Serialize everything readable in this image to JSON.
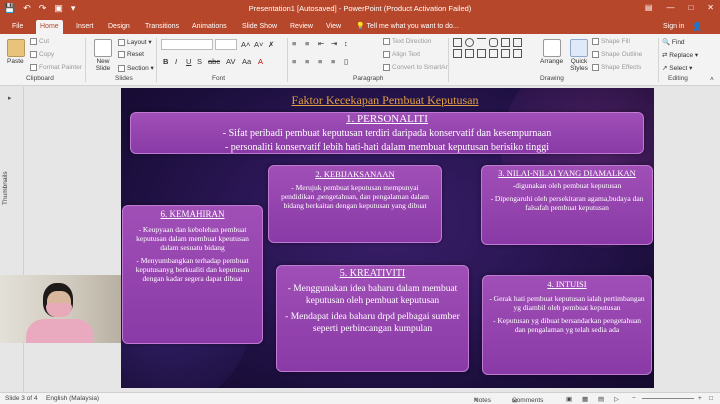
{
  "window": {
    "title": "Presentation1 [Autosaved] - PowerPoint (Product Activation Failed)",
    "controls": [
      "—",
      "□",
      "✕"
    ]
  },
  "tabs": [
    "File",
    "Home",
    "Insert",
    "Design",
    "Transitions",
    "Animations",
    "Slide Show",
    "Review",
    "View"
  ],
  "tell_me": "Tell me what you want to do...",
  "sign_in": "Sign in",
  "ribbon": {
    "clipboard": {
      "paste": "Paste",
      "cut": "Cut",
      "copy": "Copy",
      "format_painter": "Format Painter",
      "label": "Clipboard"
    },
    "slides": {
      "new_slide": "New Slide",
      "layout": "Layout",
      "reset": "Reset",
      "section": "Section",
      "label": "Slides"
    },
    "font": {
      "label": "Font"
    },
    "paragraph": {
      "text_direction": "Text Direction",
      "align_text": "Align Text",
      "convert_smartart": "Convert to SmartArt",
      "label": "Paragraph"
    },
    "drawing": {
      "arrange": "Arrange",
      "quick_styles": "Quick Styles",
      "shape_fill": "Shape Fill",
      "shape_outline": "Shape Outline",
      "shape_effects": "Shape Effects",
      "label": "Drawing"
    },
    "editing": {
      "find": "Find",
      "replace": "Replace",
      "select": "Select",
      "label": "Editing"
    }
  },
  "thumbnails_label": "Thumbnails",
  "slide": {
    "title": "Faktor Kecekapan Pembuat Keputusan",
    "boxes": {
      "personaliti": {
        "head": "1. PERSONALITI",
        "lines": [
          "- Sifat peribadi pembuat keputusan terdiri daripada konservatif dan kesempurnaan",
          "- personaliti konservatif lebih hati-hati dalam membuat keputusan berisiko tinggi"
        ]
      },
      "kebijaksanaan": {
        "head": "2. KEBIJAKSANAAN",
        "lines": [
          "- Merujuk pembuat keputusan mempunyai pendidikan ,pengetahuan, dan pengalaman dalam bidang berkaitan dengan keputusan yang dibuat"
        ]
      },
      "nilai": {
        "head": "3. NILAI-NILAI YANG DIAMALKAN",
        "lines": [
          "-digunakan oleh pembuat keputusan",
          "- Dipengaruhi oleh persekitaran agama,budaya dan falsafah pembuat keputusan"
        ]
      },
      "kemahiran": {
        "head": "6. KEMAHIRAN",
        "lines": [
          "- Keupyaan dan kebolehan pembuat keputusan dalam membuat kpeutusan dalam sesuatu bidang",
          "- Menyumbangkan terhadap pembuat keputusanyg berkualiti dan keputusan dengan kadar segera dapat dibuat"
        ]
      },
      "kreativiti": {
        "head": "5. KREATIVITI",
        "lines": [
          "- Menggunakan idea baharu dalam membuat keputusan oleh pembuat keputusan",
          "- Mendapat idea baharu drpd pelbagai sumber seperti perbincangan kumpulan"
        ]
      },
      "intuisi": {
        "head": "4. INTUISI",
        "lines": [
          "- Gerak hati pembuat keputusan ialah pertimbangan yg diambil oleh pembuat keputusan",
          "- Keputusan yg dibuat bersandarkan pengetahuan dan pengalaman yg telah sedia ada"
        ]
      }
    }
  },
  "status": {
    "slide_of": "Slide 3 of 4",
    "language": "English (Malaysia)",
    "notes": "Notes",
    "comments": "Comments"
  },
  "colors": {
    "accent": "#b7472a",
    "box": "#9a46b3",
    "title": "#e0a040"
  }
}
